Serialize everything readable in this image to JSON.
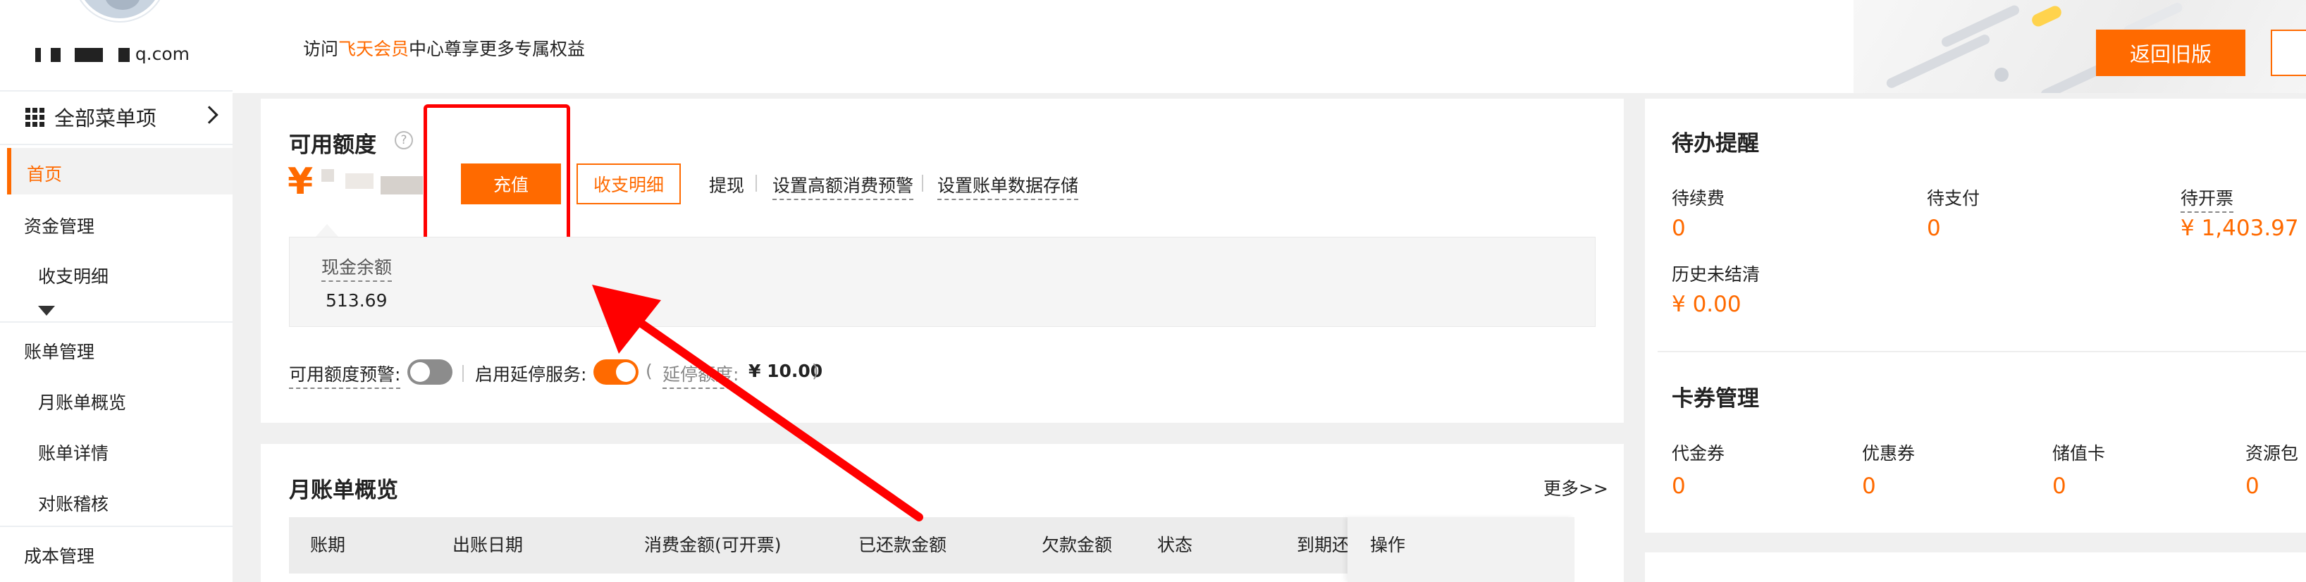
{
  "sidebar": {
    "account_suffix": "q.com",
    "menu_all_label": "全部菜单项",
    "home_label": "首页",
    "items": [
      {
        "label": "资金管理"
      },
      {
        "label": "收支明细"
      },
      {
        "label": "账单管理"
      },
      {
        "label": "月账单概览"
      },
      {
        "label": "账单详情"
      },
      {
        "label": "对账稽核"
      },
      {
        "label": "成本管理"
      }
    ]
  },
  "topbar": {
    "notice_prefix": "访问",
    "notice_accent": "飞天会员",
    "notice_suffix": "中心尊享更多专属权益",
    "back_button": "返回旧版"
  },
  "credit": {
    "title": "可用额度",
    "help_icon": "?",
    "currency": "¥",
    "recharge_button": "充值",
    "detail_button": "收支明细",
    "links": [
      "提现",
      "设置高额消费预警",
      "设置账单数据存储"
    ],
    "cash_label": "现金余额",
    "cash_value": "513.69",
    "alert_label": "可用额度预警:",
    "alert_enabled": false,
    "delay_label": "启用延停服务:",
    "delay_enabled": true,
    "delay_paren_open": "(",
    "delay_quota_label": "延停额度:",
    "delay_quota_value": "¥ 10.00",
    "delay_paren_close": ")"
  },
  "monthly": {
    "title": "月账单概览",
    "more_link": "更多>>",
    "columns": [
      "账期",
      "出账日期",
      "消费金额(可开票)",
      "已还款金额",
      "欠款金额",
      "状态",
      "到期还",
      "操作"
    ]
  },
  "todo": {
    "title": "待办提醒",
    "items": [
      {
        "label": "待续费",
        "value": "0"
      },
      {
        "label": "待支付",
        "value": "0"
      },
      {
        "label": "待开票",
        "value": "¥ 1,403.97"
      },
      {
        "label": "历史未结清",
        "value": "¥ 0.00"
      }
    ]
  },
  "coupons": {
    "title": "卡券管理",
    "items": [
      {
        "label": "代金券",
        "value": "0"
      },
      {
        "label": "优惠券",
        "value": "0"
      },
      {
        "label": "储值卡",
        "value": "0"
      },
      {
        "label": "资源包",
        "value": "0"
      }
    ]
  },
  "colors": {
    "accent": "#ff6a00",
    "annotation": "#ff0000"
  }
}
